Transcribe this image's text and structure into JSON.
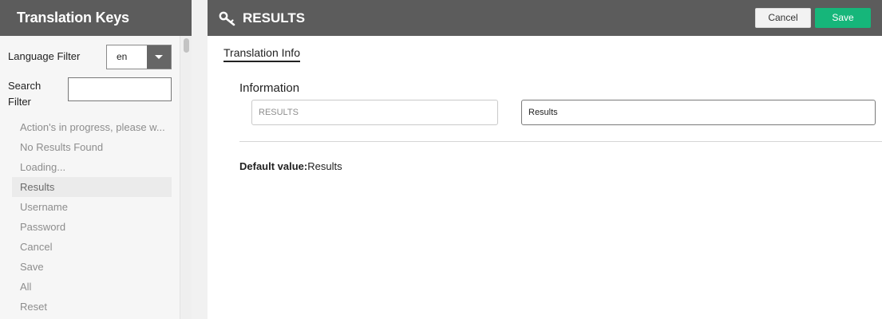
{
  "sidebar": {
    "title": "Translation Keys",
    "language_filter_label": "Language Filter",
    "language_value": "en",
    "search_filter_label": "Search Filter",
    "search_value": "",
    "items": [
      {
        "label": "Action's in progress, please w..."
      },
      {
        "label": "No Results Found"
      },
      {
        "label": "Loading..."
      },
      {
        "label": "Results"
      },
      {
        "label": "Username"
      },
      {
        "label": "Password"
      },
      {
        "label": "Cancel"
      },
      {
        "label": "Save"
      },
      {
        "label": "All"
      },
      {
        "label": "Reset"
      }
    ],
    "selected_index": 3
  },
  "header": {
    "icon": "key-icon",
    "title": "RESULTS",
    "cancel_label": "Cancel",
    "save_label": "Save"
  },
  "main": {
    "tab_label": "Translation Info",
    "section_title": "Information",
    "key_field_value": "RESULTS",
    "value_field_value": "Results",
    "default_value_label": "Default value:",
    "default_value": "Results"
  },
  "colors": {
    "header_bg": "#5c5c5c",
    "save_green": "#16b67a",
    "sidebar_bg": "#f6f6f6"
  }
}
